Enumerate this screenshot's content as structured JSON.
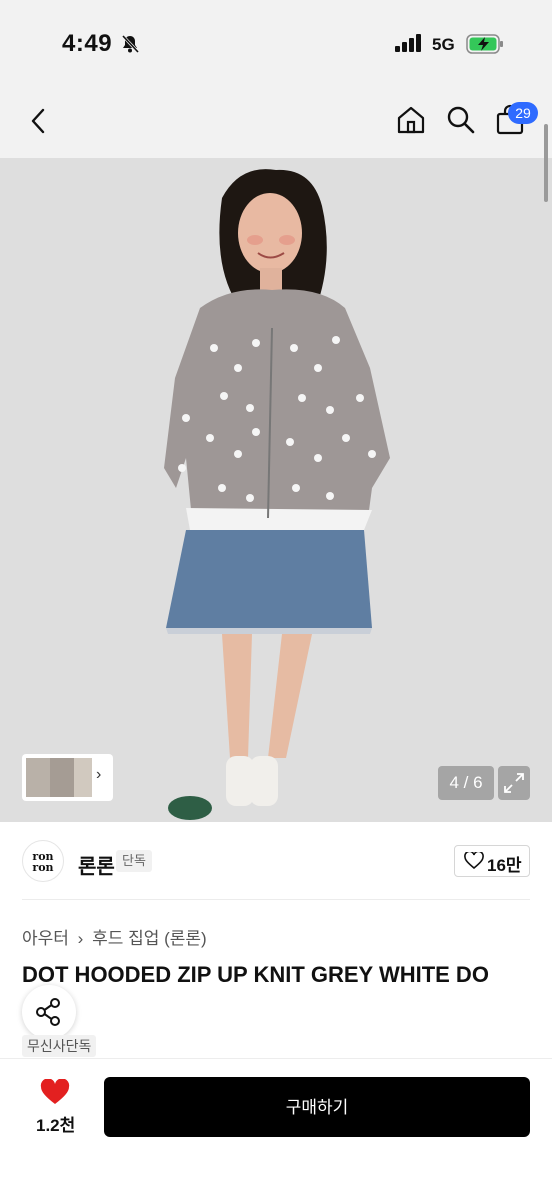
{
  "status": {
    "time": "4:49",
    "network": "5G"
  },
  "nav": {
    "cart_count": "29"
  },
  "gallery": {
    "counter": "4 / 6"
  },
  "brand": {
    "name": "론론",
    "tag": "단독",
    "logo_text": "ron ron",
    "likes": "16만"
  },
  "breadcrumb": {
    "category": "아우터",
    "subcategory": "후드 집업 (론론)"
  },
  "product": {
    "title": "DOT HOODED ZIP UP KNIT GREY WHITE DO",
    "exclusive_label": "무신사단독"
  },
  "bottom": {
    "fav_count": "1.2천",
    "buy_label": "구매하기"
  },
  "colors": {
    "accent": "#2f6bff",
    "heart": "#e32020",
    "buy_bg": "#000000"
  }
}
